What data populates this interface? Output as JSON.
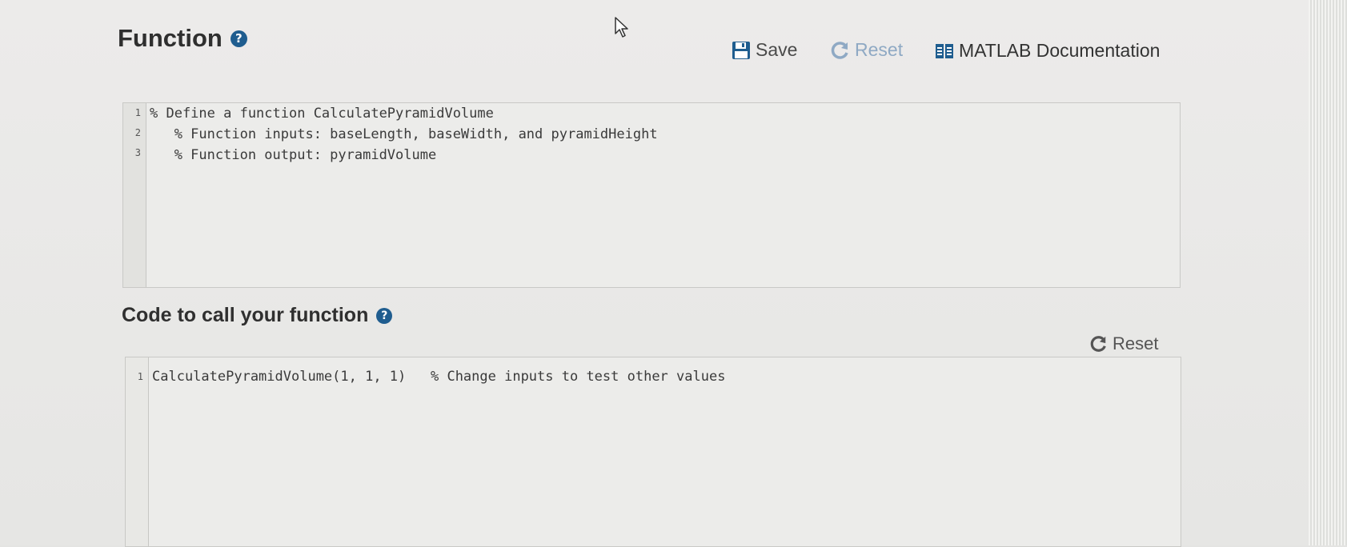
{
  "function_section": {
    "title": "Function",
    "help_icon": "?",
    "toolbar": {
      "save_label": "Save",
      "reset_label": "Reset",
      "docs_label": "MATLAB Documentation"
    },
    "editor": {
      "line_numbers": [
        "1",
        "2",
        "3"
      ],
      "lines": [
        "% Define a function CalculatePyramidVolume",
        "   % Function inputs: baseLength, baseWidth, and pyramidHeight",
        "   % Function output: pyramidVolume"
      ]
    }
  },
  "call_section": {
    "title": "Code to call your function",
    "help_icon": "?",
    "reset_label": "Reset",
    "editor": {
      "line_numbers": [
        "1"
      ],
      "lines": [
        "CalculatePyramidVolume(1, 1, 1)   % Change inputs to test other values"
      ]
    }
  },
  "icons": {
    "save": "floppy-disk-icon",
    "reset": "circular-arrow-icon",
    "docs": "book-icon",
    "help": "question-circle-icon",
    "pointer": "mouse-pointer-icon"
  },
  "colors": {
    "help_icon": "#1f5d8f",
    "reset_disabled": "#8fa9c4",
    "docs_icon": "#1f5d8f"
  }
}
